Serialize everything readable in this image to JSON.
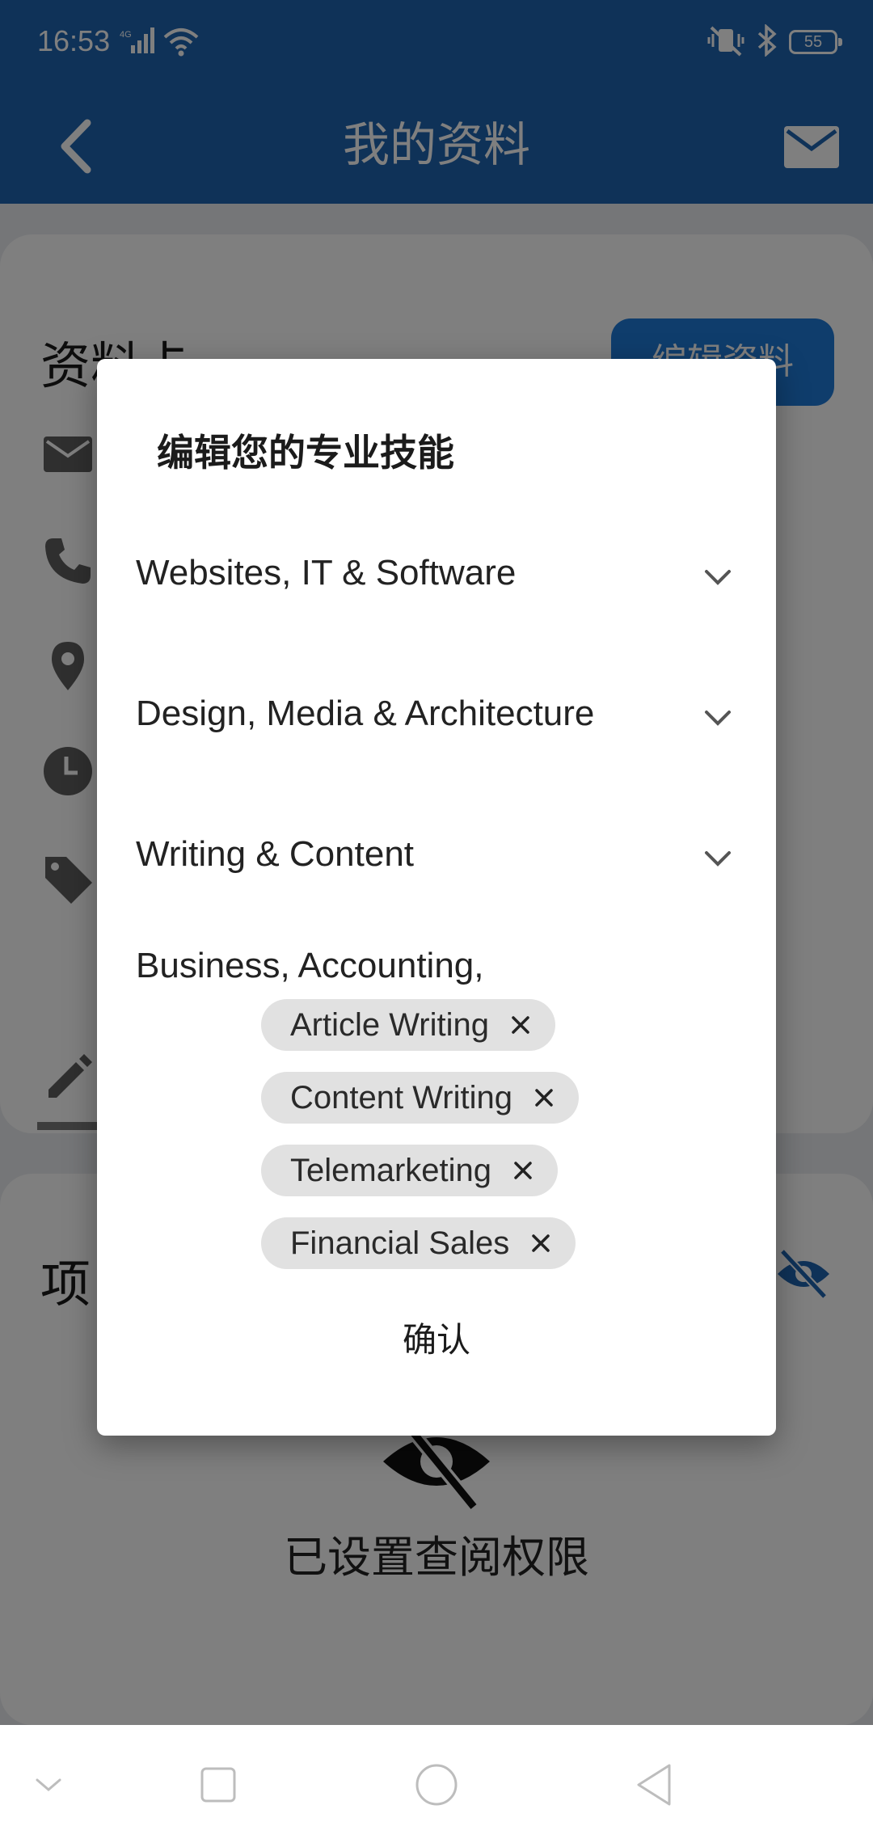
{
  "status_bar": {
    "time": "16:53",
    "battery": "55"
  },
  "app_bar": {
    "title": "我的资料"
  },
  "profile_card": {
    "title": "资料卡",
    "edit_button": "编辑资料"
  },
  "projects_card": {
    "title_partial": "项",
    "permission_text": "已设置查阅权限"
  },
  "dialog": {
    "title": "编辑您的专业技能",
    "categories": [
      "Websites, IT & Software",
      "Design, Media & Architecture",
      "Writing & Content",
      "Business, Accounting,"
    ],
    "selected_skills": [
      "Article Writing",
      "Content Writing",
      "Telemarketing",
      "Financial Sales"
    ],
    "confirm_label": "确认"
  },
  "colors": {
    "app_bar": "#1e64b0",
    "accent_button": "#1e7ad8",
    "chip_bg": "#e1e1e1"
  }
}
